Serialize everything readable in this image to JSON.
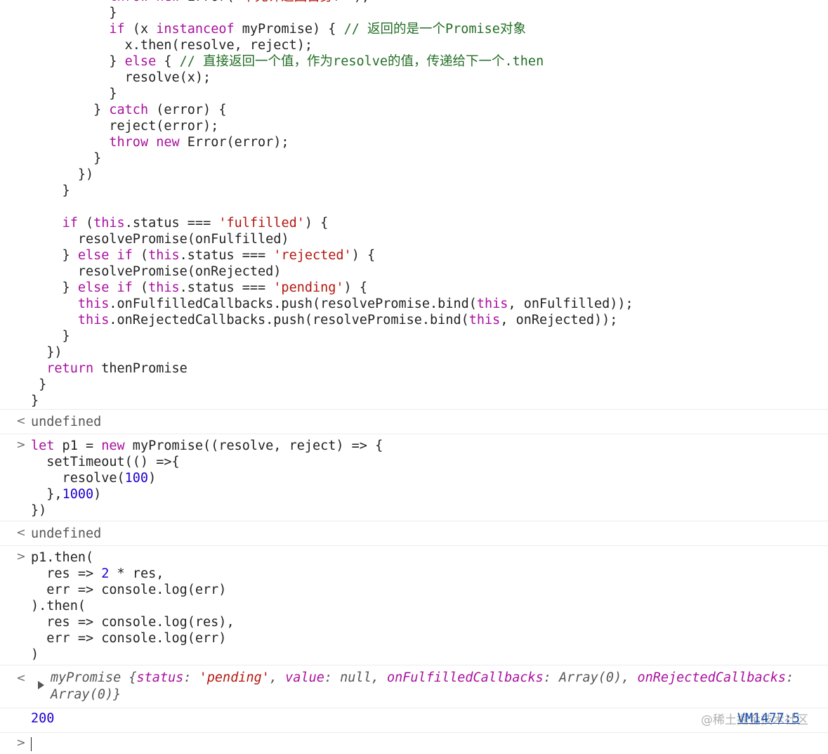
{
  "block1": {
    "lines": [
      [
        {
          "t": "          ",
          "c": "plain"
        },
        {
          "t": "throw new",
          "c": "kw"
        },
        {
          "t": " Error(",
          "c": "plain"
        },
        {
          "t": "'不允许返回自身！'",
          "c": "str"
        },
        {
          "t": ");",
          "c": "plain"
        }
      ],
      [
        {
          "t": "          }",
          "c": "plain"
        }
      ],
      [
        {
          "t": "          ",
          "c": "plain"
        },
        {
          "t": "if",
          "c": "kw"
        },
        {
          "t": " (x ",
          "c": "plain"
        },
        {
          "t": "instanceof",
          "c": "kw"
        },
        {
          "t": " myPromise) { ",
          "c": "plain"
        },
        {
          "t": "// 返回的是一个Promise对象",
          "c": "cmt"
        }
      ],
      [
        {
          "t": "            x.then(resolve, reject);",
          "c": "plain"
        }
      ],
      [
        {
          "t": "          } ",
          "c": "plain"
        },
        {
          "t": "else",
          "c": "kw"
        },
        {
          "t": " { ",
          "c": "plain"
        },
        {
          "t": "// 直接返回一个值，作为resolve的值，传递给下一个.then",
          "c": "cmt"
        }
      ],
      [
        {
          "t": "            resolve(x);",
          "c": "plain"
        }
      ],
      [
        {
          "t": "          }",
          "c": "plain"
        }
      ],
      [
        {
          "t": "        } ",
          "c": "plain"
        },
        {
          "t": "catch",
          "c": "kw"
        },
        {
          "t": " (error) {",
          "c": "plain"
        }
      ],
      [
        {
          "t": "          reject(error);",
          "c": "plain"
        }
      ],
      [
        {
          "t": "          ",
          "c": "plain"
        },
        {
          "t": "throw new",
          "c": "kw"
        },
        {
          "t": " Error(error);",
          "c": "plain"
        }
      ],
      [
        {
          "t": "        }",
          "c": "plain"
        }
      ],
      [
        {
          "t": "      })",
          "c": "plain"
        }
      ],
      [
        {
          "t": "    }",
          "c": "plain"
        }
      ],
      [
        {
          "t": "",
          "c": "plain"
        }
      ],
      [
        {
          "t": "    ",
          "c": "plain"
        },
        {
          "t": "if",
          "c": "kw"
        },
        {
          "t": " (",
          "c": "plain"
        },
        {
          "t": "this",
          "c": "kw"
        },
        {
          "t": ".status === ",
          "c": "plain"
        },
        {
          "t": "'fulfilled'",
          "c": "str"
        },
        {
          "t": ") {",
          "c": "plain"
        }
      ],
      [
        {
          "t": "      resolvePromise(onFulfilled)",
          "c": "plain"
        }
      ],
      [
        {
          "t": "    } ",
          "c": "plain"
        },
        {
          "t": "else if",
          "c": "kw"
        },
        {
          "t": " (",
          "c": "plain"
        },
        {
          "t": "this",
          "c": "kw"
        },
        {
          "t": ".status === ",
          "c": "plain"
        },
        {
          "t": "'rejected'",
          "c": "str"
        },
        {
          "t": ") {",
          "c": "plain"
        }
      ],
      [
        {
          "t": "      resolvePromise(onRejected)",
          "c": "plain"
        }
      ],
      [
        {
          "t": "    } ",
          "c": "plain"
        },
        {
          "t": "else if",
          "c": "kw"
        },
        {
          "t": " (",
          "c": "plain"
        },
        {
          "t": "this",
          "c": "kw"
        },
        {
          "t": ".status === ",
          "c": "plain"
        },
        {
          "t": "'pending'",
          "c": "str"
        },
        {
          "t": ") {",
          "c": "plain"
        }
      ],
      [
        {
          "t": "      ",
          "c": "plain"
        },
        {
          "t": "this",
          "c": "kw"
        },
        {
          "t": ".onFulfilledCallbacks.push(resolvePromise.bind(",
          "c": "plain"
        },
        {
          "t": "this",
          "c": "kw"
        },
        {
          "t": ", onFulfilled));",
          "c": "plain"
        }
      ],
      [
        {
          "t": "      ",
          "c": "plain"
        },
        {
          "t": "this",
          "c": "kw"
        },
        {
          "t": ".onRejectedCallbacks.push(resolvePromise.bind(",
          "c": "plain"
        },
        {
          "t": "this",
          "c": "kw"
        },
        {
          "t": ", onRejected));",
          "c": "plain"
        }
      ],
      [
        {
          "t": "    }",
          "c": "plain"
        }
      ],
      [
        {
          "t": "  })",
          "c": "plain"
        }
      ],
      [
        {
          "t": "  ",
          "c": "plain"
        },
        {
          "t": "return",
          "c": "kw"
        },
        {
          "t": " thenPromise",
          "c": "plain"
        }
      ],
      [
        {
          "t": " }",
          "c": "plain"
        }
      ],
      [
        {
          "t": "}",
          "c": "plain"
        }
      ]
    ]
  },
  "result1": {
    "text": "undefined",
    "prompt": "<"
  },
  "block2": {
    "prompt": ">",
    "lines": [
      [
        {
          "t": "let",
          "c": "kw"
        },
        {
          "t": " p1 = ",
          "c": "plain"
        },
        {
          "t": "new",
          "c": "kw"
        },
        {
          "t": " myPromise((resolve, reject) => {",
          "c": "plain"
        }
      ],
      [
        {
          "t": "  setTimeout(() =>{",
          "c": "plain"
        }
      ],
      [
        {
          "t": "    resolve(",
          "c": "plain"
        },
        {
          "t": "100",
          "c": "num"
        },
        {
          "t": ")",
          "c": "plain"
        }
      ],
      [
        {
          "t": "  },",
          "c": "plain"
        },
        {
          "t": "1000",
          "c": "num"
        },
        {
          "t": ")",
          "c": "plain"
        }
      ],
      [
        {
          "t": "})",
          "c": "plain"
        }
      ]
    ]
  },
  "result2": {
    "text": "undefined",
    "prompt": "<"
  },
  "block3": {
    "prompt": ">",
    "lines": [
      [
        {
          "t": "p1.then(",
          "c": "plain"
        }
      ],
      [
        {
          "t": "  res => ",
          "c": "plain"
        },
        {
          "t": "2",
          "c": "num"
        },
        {
          "t": " * res,",
          "c": "plain"
        }
      ],
      [
        {
          "t": "  err => console.log(err)",
          "c": "plain"
        }
      ],
      [
        {
          "t": ").then(",
          "c": "plain"
        }
      ],
      [
        {
          "t": "  res => console.log(res),",
          "c": "plain"
        }
      ],
      [
        {
          "t": "  err => console.log(err)",
          "c": "plain"
        }
      ],
      [
        {
          "t": ")",
          "c": "plain"
        }
      ]
    ]
  },
  "result3": {
    "prompt": "<",
    "class_name": "myPromise",
    "open": "{",
    "status_key": "status",
    "status_val": "'pending'",
    "value_key": "value",
    "value_val": "null",
    "fulfilled_key": "onFulfilledCallbacks",
    "fulfilled_val": "Array(0)",
    "rejected_key": "onRejectedCallbacks",
    "rejected_val": "Array(0)",
    "close": "}"
  },
  "log": {
    "value": "200",
    "source": "VM1477:5"
  },
  "watermark": "@稀土掘金技术社区",
  "colors": {
    "keyword": "#a9109f",
    "string": "#b4160e",
    "number": "#1c00cf",
    "comment": "#236e25",
    "link": "#1a4fa8"
  }
}
